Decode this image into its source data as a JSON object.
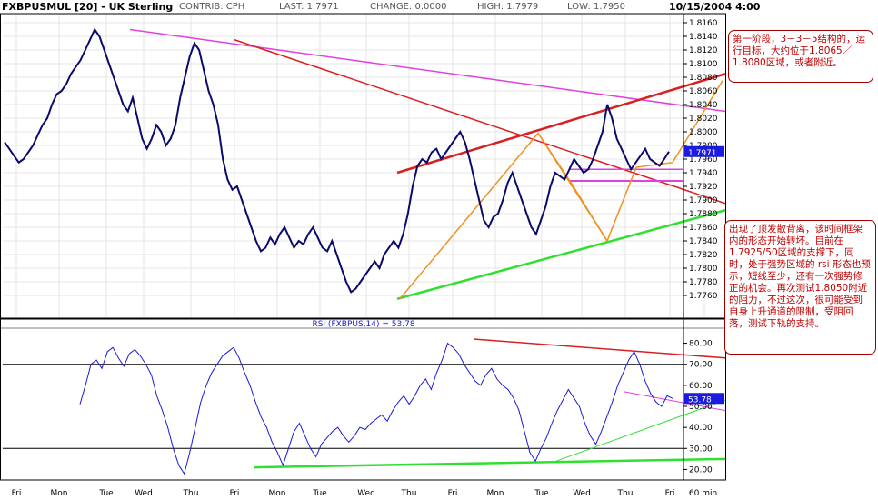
{
  "header": {
    "symbol": "FXBPUSMUL [20] - UK Sterling",
    "contrib_label": "CONTRIB:",
    "contrib": "CPH",
    "last_label": "LAST:",
    "last": "1.7971",
    "change_label": "CHANGE:",
    "change": "0.0000",
    "high_label": "HIGH:",
    "high": "1.7979",
    "low_label": "LOW:",
    "low": "1.7950",
    "datetime": "10/15/2004 4:00"
  },
  "annotations": {
    "top_note": "第一阶段，3－3－5结构的，运行目标，大约位于1.8065／1.8080区域，或者附近。",
    "bottom_note": "出现了顶发散背离，该时间框架内的形态开始转坏。目前在1.7925/50区域的支撑下，同时，处于强势区域的 rsi 形态也预示，短线至少，还有一次强势修正的机会。再次测试1.8050附近的阻力，不过这次，很可能受到自身上升通道的限制，受阻回落，测试下轨的支持。"
  },
  "colors": {
    "price_line": "#0a0a6a",
    "rsi_line": "#1a1ad8",
    "fan_magenta": "#e040e0",
    "trend_red": "#d82020",
    "trend_orange": "#f09020",
    "trend_green": "#30e030",
    "label_box": "#1a1ae0"
  },
  "chart_data": [
    {
      "type": "line",
      "title": "FXBPUSMUL [20] - UK Sterling",
      "ylim": [
        1.774,
        1.816
      ],
      "y_ticks": [
        "1.8160",
        "1.8140",
        "1.8120",
        "1.8100",
        "1.8080",
        "1.8060",
        "1.8040",
        "1.8020",
        "1.8000",
        "1.7980",
        "1.7960",
        "1.7940",
        "1.7920",
        "1.7900",
        "1.7880",
        "1.7860",
        "1.7840",
        "1.7820",
        "1.7800",
        "1.7780",
        "1.7760"
      ],
      "last_value_label": "1.7971",
      "last_value": 1.7971,
      "x_tick_labels": [
        "Fri",
        "Mon",
        "Tue",
        "Wed",
        "Thu",
        "Fri",
        "Mon",
        "Tue",
        "Wed",
        "Thu",
        "Fri",
        "Mon",
        "Tue",
        "Wed",
        "Thu",
        "Fri",
        "60 min."
      ],
      "series": [
        {
          "values": [
            1.7985,
            1.7975,
            1.7965,
            1.7955,
            1.796,
            1.797,
            1.798,
            1.7995,
            1.801,
            1.802,
            1.804,
            1.8055,
            1.806,
            1.807,
            1.8085,
            1.8095,
            1.8105,
            1.812,
            1.8135,
            1.815,
            1.814,
            1.812,
            1.81,
            1.808,
            1.806,
            1.804,
            1.803,
            1.805,
            1.802,
            1.799,
            1.7975,
            1.799,
            1.801,
            1.8,
            1.798,
            1.799,
            1.801,
            1.805,
            1.808,
            1.811,
            1.813,
            1.812,
            1.809,
            1.806,
            1.804,
            1.801,
            1.796,
            1.793,
            1.7915,
            1.792,
            1.79,
            1.788,
            1.786,
            1.784,
            1.7825,
            1.783,
            1.7845,
            1.7835,
            1.785,
            1.786,
            1.7845,
            1.783,
            1.784,
            1.7835,
            1.785,
            1.786,
            1.7845,
            1.783,
            1.7825,
            1.784,
            1.782,
            1.78,
            1.778,
            1.7765,
            1.777,
            1.778,
            1.779,
            1.78,
            1.781,
            1.78,
            1.782,
            1.783,
            1.784,
            1.783,
            1.785,
            1.788,
            1.792,
            1.795,
            1.796,
            1.7955,
            1.797,
            1.7975,
            1.796,
            1.797,
            1.798,
            1.799,
            1.8,
            1.7985,
            1.796,
            1.793,
            1.79,
            1.787,
            1.786,
            1.7875,
            1.788,
            1.79,
            1.7925,
            1.794,
            1.792,
            1.79,
            1.788,
            1.786,
            1.785,
            1.787,
            1.789,
            1.792,
            1.794,
            1.7935,
            1.793,
            1.7945,
            1.796,
            1.795,
            1.794,
            1.7945,
            1.796,
            1.798,
            1.8,
            1.804,
            1.802,
            1.799,
            1.7975,
            1.796,
            1.7945,
            1.7955,
            1.7965,
            1.7975,
            1.796,
            1.7955,
            1.795,
            1.796,
            1.7971
          ]
        }
      ]
    },
    {
      "type": "line",
      "title": "RSI (FXBPUS,14) = 53.78",
      "ylim": [
        15,
        85
      ],
      "y_ticks": [
        "80.00",
        "70.00",
        "60.00",
        "50.00",
        "40.00",
        "30.00",
        "20.00"
      ],
      "reference_lines": [
        70,
        30
      ],
      "last_value_label": "53.78",
      "last_value": 53.78,
      "series": [
        {
          "values": [
            51,
            60,
            70,
            72,
            68,
            76,
            78,
            73,
            69,
            75,
            77,
            74,
            70,
            65,
            55,
            48,
            40,
            30,
            22,
            18,
            28,
            40,
            52,
            60,
            66,
            70,
            74,
            76,
            78,
            73,
            66,
            60,
            52,
            45,
            40,
            33,
            28,
            22,
            30,
            38,
            42,
            36,
            30,
            26,
            32,
            35,
            38,
            40,
            36,
            33,
            36,
            40,
            39,
            42,
            44,
            46,
            43,
            48,
            52,
            55,
            51,
            55,
            60,
            63,
            58,
            66,
            72,
            80,
            78,
            75,
            70,
            66,
            62,
            60,
            65,
            68,
            63,
            60,
            58,
            54,
            48,
            38,
            28,
            24,
            30,
            35,
            42,
            48,
            53,
            58,
            54,
            50,
            42,
            36,
            32,
            38,
            45,
            52,
            60,
            66,
            72,
            76,
            70,
            62,
            56,
            52,
            50,
            55,
            53.78
          ]
        }
      ]
    }
  ]
}
